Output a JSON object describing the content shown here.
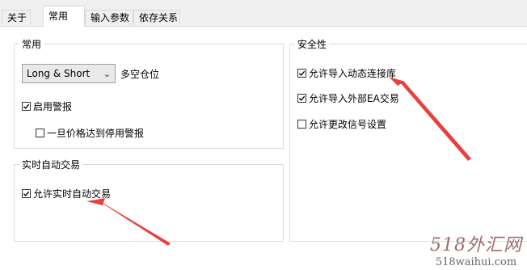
{
  "tabs": [
    {
      "label": "关于",
      "active": false
    },
    {
      "label": "常用",
      "active": true
    },
    {
      "label": "输入参数",
      "active": false
    },
    {
      "label": "依存关系",
      "active": false
    }
  ],
  "common_group": {
    "legend": "常用",
    "mode_select": {
      "selected": "Long & Short",
      "caption": "多空仓位"
    },
    "enable_alerts": {
      "label": "启用警报",
      "checked": true
    },
    "alert_on_price": {
      "label": "一旦价格达到停用警报",
      "checked": false
    }
  },
  "live_group": {
    "legend": "实时自动交易",
    "allow_live": {
      "label": "允许实时自动交易",
      "checked": true
    }
  },
  "security_group": {
    "legend": "安全性",
    "allow_dll": {
      "label": "允许导入动态连接库",
      "checked": true
    },
    "allow_ea": {
      "label": "允许导入外部EA交易",
      "checked": true
    },
    "allow_signal": {
      "label": "允许更改信号设置",
      "checked": false
    }
  },
  "watermark": {
    "big": "518外汇网",
    "small": "518waihui.com"
  },
  "colors": {
    "arrow": "#e8413b",
    "panel_border": "#dcdcdc",
    "tab_bg": "#f0f0f0"
  }
}
